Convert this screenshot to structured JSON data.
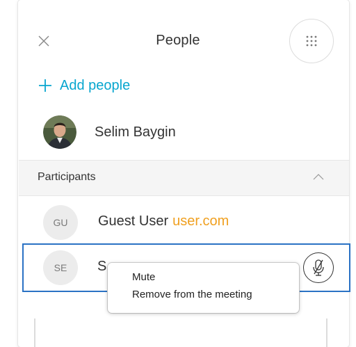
{
  "header": {
    "title": "People"
  },
  "add_people": {
    "label": "Add people"
  },
  "host": {
    "name": "Selim Baygin"
  },
  "participants_section": {
    "label": "Participants"
  },
  "participants": [
    {
      "initials": "GU",
      "name": "Guest User",
      "domain": "user.com"
    },
    {
      "initials": "SE",
      "name": "S"
    }
  ],
  "context_menu": {
    "items": [
      "Mute",
      "Remove from the meeting"
    ]
  },
  "colors": {
    "accent": "#07a6cf",
    "domain": "#f0a020",
    "selection": "#2a72c4"
  },
  "icons": [
    "close-icon",
    "dialpad-icon",
    "plus-icon",
    "chevron-up-icon",
    "mic-muted-icon"
  ]
}
